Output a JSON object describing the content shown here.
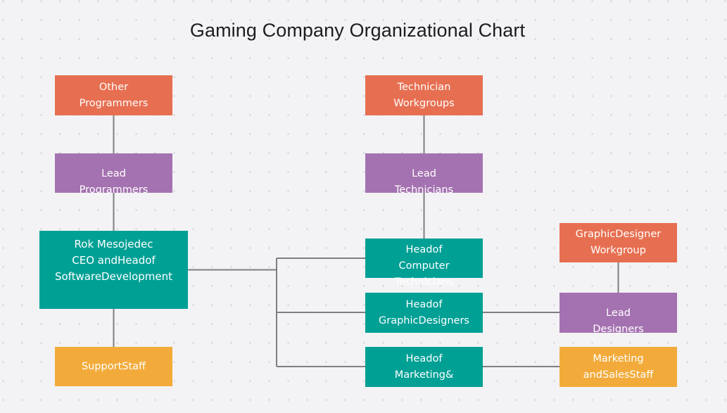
{
  "title": "Gaming Company Organizational Chart",
  "colors": {
    "workgroup": "#e76f51",
    "lead": "#a472b0",
    "head": "#00a095",
    "staff": "#f2ab3b",
    "connector": "#7f7f7f",
    "background": "#f3f3f5"
  },
  "nodes": {
    "other_programmers": {
      "lines": [
        "Other",
        "Programmers"
      ]
    },
    "lead_programmers": {
      "lines": [
        "Lead",
        "Programmers"
      ]
    },
    "ceo": {
      "lines": [
        "Rok Mesojedec",
        "CEO  andHeadof",
        "SoftwareDevelopment"
      ]
    },
    "support_staff": {
      "lines": [
        "SupportStaff"
      ]
    },
    "technician_workgroups": {
      "lines": [
        "Technician",
        "Workgroups"
      ]
    },
    "lead_technicians": {
      "lines": [
        "Lead",
        "Technicians"
      ]
    },
    "head_computer_technicians": {
      "lines": [
        "Headof",
        "Computer",
        "Technicians"
      ]
    },
    "head_graphic_designers": {
      "lines": [
        "Headof",
        "GraphicDesigners"
      ]
    },
    "head_marketing": {
      "lines": [
        "Headof",
        "Marketing&"
      ]
    },
    "graphic_designer_workgroup": {
      "lines": [
        "GraphicDesigner",
        "Workgroup"
      ]
    },
    "lead_designers": {
      "lines": [
        "Lead",
        "Designers"
      ]
    },
    "marketing_sales_staff": {
      "lines": [
        "Marketing",
        "andSalesStaff"
      ]
    }
  }
}
